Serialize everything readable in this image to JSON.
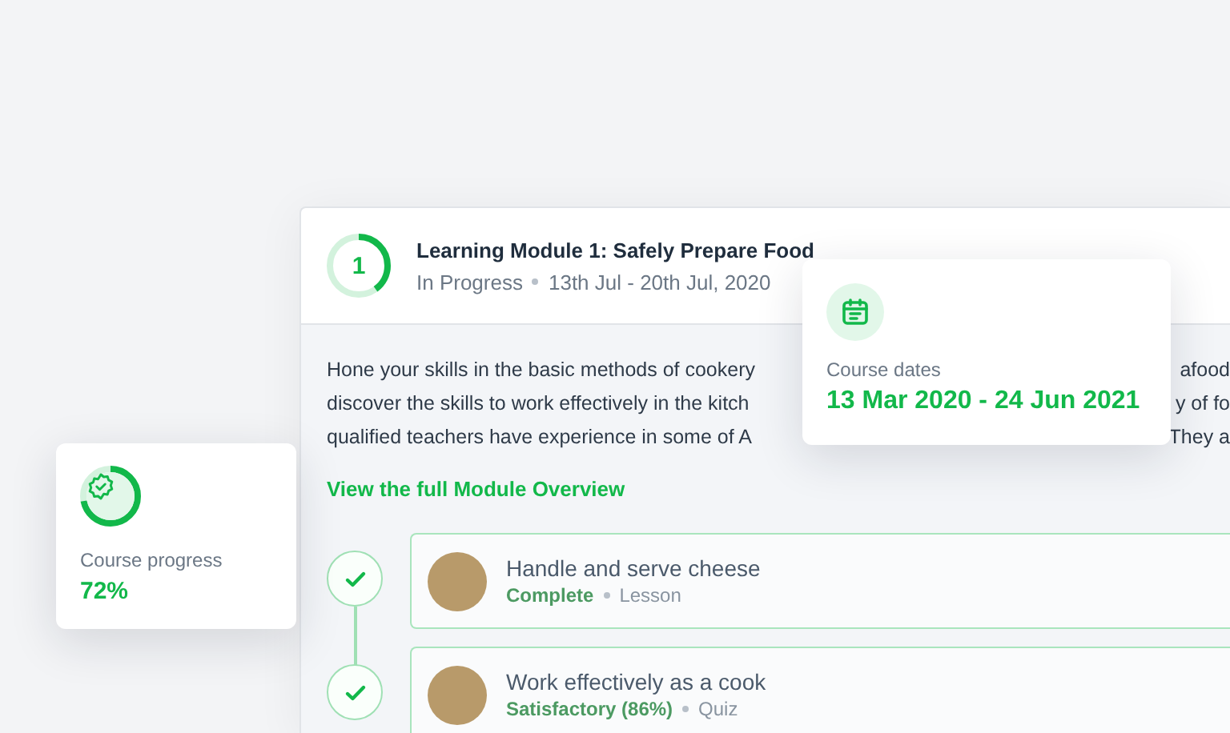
{
  "module": {
    "number": "1",
    "level": 0.4,
    "title": "Learning Module 1: Safely Prepare Food",
    "status": "In Progress",
    "dates": "13th Jul - 20th Jul, 2020"
  },
  "description_lines": [
    {
      "left": "Hone your skills in the basic methods of cookery",
      "right": "afood"
    },
    {
      "left": "discover the skills to work effectively in the kitch",
      "right": "y of fo"
    },
    {
      "left": "qualified teachers have experience in some of A",
      "right": "They a"
    }
  ],
  "overview_link": "View the full Module Overview",
  "lessons": [
    {
      "title": "Handle and serve cheese",
      "result": "Complete",
      "type": "Lesson",
      "done": true
    },
    {
      "title": "Work effectively as a cook",
      "result": "Satisfactory (86%)",
      "type": "Quiz",
      "done": true
    }
  ],
  "dates_card": {
    "label": "Course dates",
    "value": "13 Mar 2020 - 24 Jun 2021"
  },
  "progress_card": {
    "level": 0.72,
    "label": "Course progress",
    "value": "72%"
  }
}
